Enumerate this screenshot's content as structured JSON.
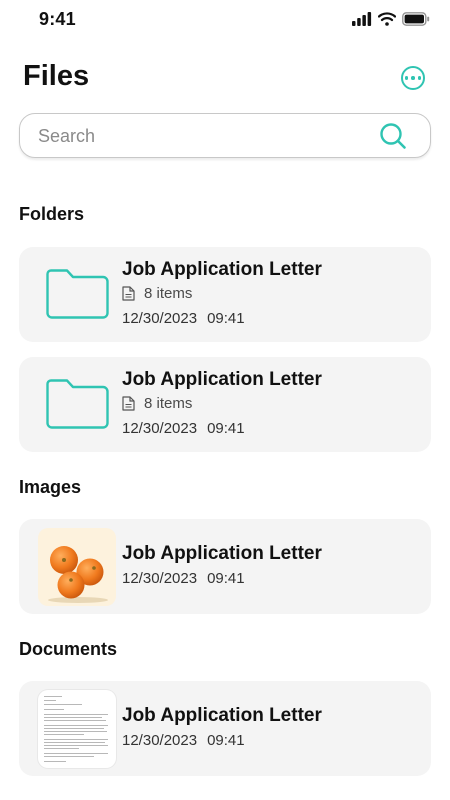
{
  "status_bar": {
    "time": "9:41"
  },
  "header": {
    "title": "Files"
  },
  "search": {
    "placeholder": "Search"
  },
  "sections": {
    "folders": "Folders",
    "images": "Images",
    "documents": "Documents"
  },
  "folders": [
    {
      "name": "Job Application Letter",
      "count": "8 items",
      "date": "12/30/2023",
      "time": "09:41"
    },
    {
      "name": "Job Application Letter",
      "count": "8 items",
      "date": "12/30/2023",
      "time": "09:41"
    }
  ],
  "images": [
    {
      "name": "Job Application Letter",
      "date": "12/30/2023",
      "time": "09:41",
      "thumbnail": "oranges"
    }
  ],
  "documents": [
    {
      "name": "Job Application Letter",
      "date": "12/30/2023",
      "time": "09:41",
      "thumbnail": "letter-page"
    }
  ],
  "colors": {
    "accent": "#2fc4b2",
    "card_bg": "#f4f4f4",
    "text": "#111111"
  },
  "icons": [
    "signal-icon",
    "wifi-icon",
    "battery-icon",
    "more-icon",
    "search-icon",
    "folder-icon",
    "file-icon"
  ]
}
